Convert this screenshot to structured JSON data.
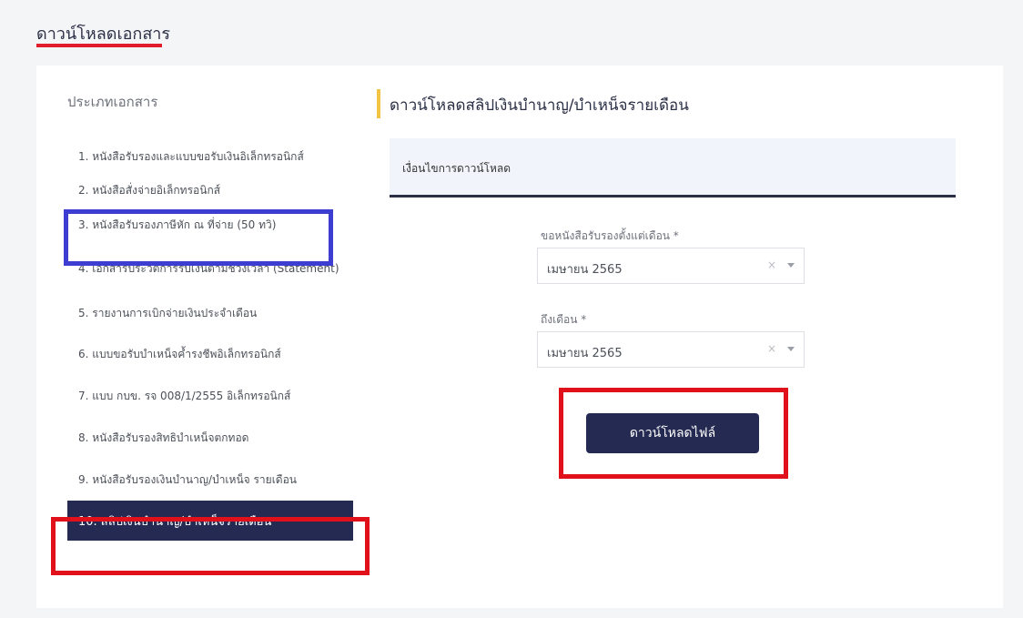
{
  "page": {
    "title": "ดาวน์โหลดเอกสาร"
  },
  "sidebar": {
    "heading": "ประเภทเอกสาร",
    "items": [
      {
        "label": "1. หนังสือรับรองและแบบขอรับเงินอิเล็กทรอนิกส์"
      },
      {
        "label": "2. หนังสือสั่งจ่ายอิเล็กทรอนิกส์"
      },
      {
        "label": "3. หนังสือรับรองภาษีหัก ณ ที่จ่าย (50 ทวิ)"
      },
      {
        "label": "4. เอกสารประวัติการรับเงินตามช่วงเวลา (Statement)"
      },
      {
        "label": "5. รายงานการเบิกจ่ายเงินประจำเดือน"
      },
      {
        "label": "6. แบบขอรับบำเหน็จค้ำรงชีพอิเล็กทรอนิกส์"
      },
      {
        "label": "7. แบบ กบข. รจ 008/1/2555 อิเล็กทรอนิกส์"
      },
      {
        "label": "8. หนังสือรับรองสิทธิบำเหน็จตกทอด"
      },
      {
        "label": "9. หนังสือรับรองเงินบำนาญ/บำเหน็จ รายเดือน"
      },
      {
        "label": "10. สลิปเงินบำนาญ/บำเหน็จรายเดือน"
      }
    ],
    "active_index": 9
  },
  "main": {
    "section_title": "ดาวน์โหลดสลิปเงินบำนาญ/บำเหน็จรายเดือน",
    "conditions_title": "เงื่อนไขการดาวน์โหลด",
    "from_label": "ขอหนังสือรับรองตั้งแต่เดือน *",
    "from_value": "เมษายน 2565",
    "to_label": "ถึงเดือน *",
    "to_value": "เมษายน 2565",
    "clear_symbol": "×",
    "download_label": "ดาวน์โหลดไฟล์"
  },
  "colors": {
    "navy": "#252a52",
    "highlight_red": "#e0111b",
    "highlight_blue": "#3d3dd1",
    "accent_yellow": "#f2c443"
  }
}
